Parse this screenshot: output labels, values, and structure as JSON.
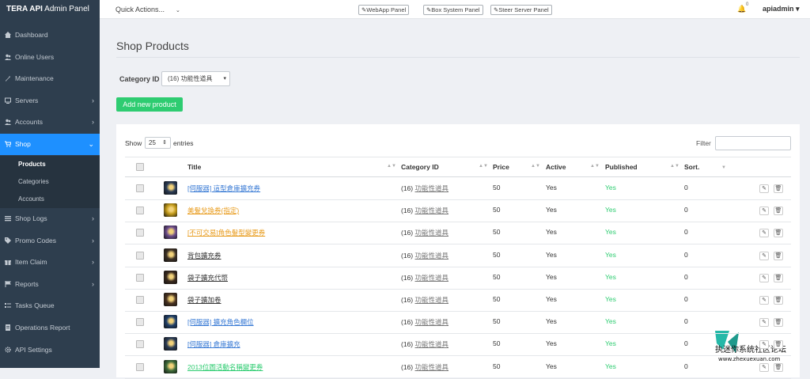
{
  "brand": {
    "bold": "TERA API",
    "rest": " Admin Panel"
  },
  "sidebar": {
    "items": [
      {
        "label": "Dashboard",
        "icon": "dashboard-icon"
      },
      {
        "label": "Online Users",
        "icon": "users-icon"
      },
      {
        "label": "Maintenance",
        "icon": "wrench-icon"
      },
      {
        "label": "Servers",
        "icon": "monitor-icon"
      },
      {
        "label": "Accounts",
        "icon": "users-icon"
      },
      {
        "label": "Shop",
        "icon": "cart-icon"
      },
      {
        "label": "Shop Logs",
        "icon": "list-icon"
      },
      {
        "label": "Promo Codes",
        "icon": "tag-icon"
      },
      {
        "label": "Item Claim",
        "icon": "gift-icon"
      },
      {
        "label": "Reports",
        "icon": "flag-icon"
      },
      {
        "label": "Tasks Queue",
        "icon": "tasks-icon"
      },
      {
        "label": "Operations Report",
        "icon": "report-icon"
      },
      {
        "label": "API Settings",
        "icon": "gear-icon"
      }
    ],
    "shop_sub": [
      "Products",
      "Categories",
      "Accounts"
    ]
  },
  "topbar": {
    "quick_actions": "Quick Actions...",
    "buttons": [
      "WebApp Panel",
      "Box System Panel",
      "Steer Server Panel"
    ],
    "notifications": "0",
    "user": "apiadmin"
  },
  "page": {
    "title": "Shop Products",
    "category_label": "Category ID",
    "category_value": "(16) 功能性道具",
    "add_button": "Add new product",
    "show_label": "Show",
    "show_value": "25",
    "entries_label": "entries",
    "filter_label": "Filter"
  },
  "table": {
    "headers": [
      "Title",
      "Category ID",
      "Price",
      "Active",
      "Published",
      "Sort."
    ],
    "rows": [
      {
        "title": "[伺服器] 這型倉庫擴充券",
        "title_color": "#3a7bd5",
        "category": "(16) 功能性道具",
        "price": "50",
        "active": "Yes",
        "published": "Yes",
        "sort": "0",
        "thumb": "#2a3b55"
      },
      {
        "title": "美髮兌換券(指定)",
        "title_color": "#e89b1c",
        "category": "(16) 功能性道具",
        "price": "50",
        "active": "Yes",
        "published": "Yes",
        "sort": "0",
        "thumb": "#c29a1a"
      },
      {
        "title": "[不可交易]角色髮型變更券",
        "title_color": "#e89b1c",
        "category": "(16) 功能性道具",
        "price": "50",
        "active": "Yes",
        "published": "Yes",
        "sort": "0",
        "thumb": "#6b4c8c"
      },
      {
        "title": "背包擴充券",
        "title_color": "#333333",
        "category": "(16) 功能性道具",
        "price": "50",
        "active": "Yes",
        "published": "Yes",
        "sort": "0",
        "thumb": "#3c3025"
      },
      {
        "title": "袋子擴充代幣",
        "title_color": "#333333",
        "category": "(16) 功能性道具",
        "price": "50",
        "active": "Yes",
        "published": "Yes",
        "sort": "0",
        "thumb": "#3a2a1e"
      },
      {
        "title": "袋子擴加卷",
        "title_color": "#333333",
        "category": "(16) 功能性道具",
        "price": "50",
        "active": "Yes",
        "published": "Yes",
        "sort": "0",
        "thumb": "#4a3322"
      },
      {
        "title": "[伺服器] 擴充角色欄位",
        "title_color": "#3a7bd5",
        "category": "(16) 功能性道具",
        "price": "50",
        "active": "Yes",
        "published": "Yes",
        "sort": "0",
        "thumb": "#1f3f6a"
      },
      {
        "title": "[伺服器] 倉庫擴充",
        "title_color": "#3a7bd5",
        "category": "(16) 功能性道具",
        "price": "50",
        "active": "Yes",
        "published": "Yes",
        "sort": "0",
        "thumb": "#2a3b55"
      },
      {
        "title": "2013位圖活動名稱變更券",
        "title_color": "#2ecc71",
        "category": "(16) 功能性道具",
        "price": "50",
        "active": "Yes",
        "published": "Yes",
        "sort": "0",
        "thumb": "#3d6b3a"
      }
    ]
  },
  "watermark": {
    "line1": "执迷你系统社区论坛",
    "line2": "www.zhexuexuan.com"
  },
  "colors": {
    "sidebar": "#2e3e4e",
    "active": "#1e90ff",
    "success": "#2ecc71",
    "link": "#3a7bd5",
    "warning": "#e89b1c"
  }
}
